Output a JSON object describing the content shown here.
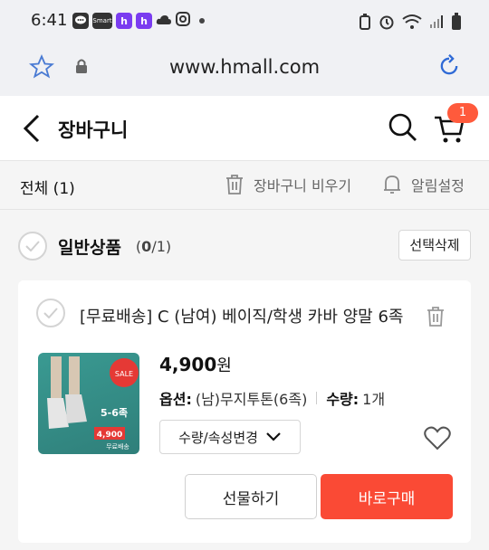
{
  "status_bar": {
    "time": "6:41",
    "icons": [
      "chat-icon",
      "smart-icon",
      "h-app-icon",
      "h-app-icon",
      "cloud-icon",
      "instagram-icon"
    ],
    "smart_label": "Smart",
    "h_label": "h"
  },
  "browser": {
    "url": "www.hmall.com"
  },
  "header": {
    "title": "장바구니",
    "cart_badge": "1"
  },
  "toolbar": {
    "all_label": "전체 (1)",
    "clear_label": "장바구니 비우기",
    "alarm_label": "알림설정"
  },
  "section": {
    "title": "일반상품",
    "count_selected": "0",
    "count_total": "/1)",
    "count_open": "(",
    "delete_selected_label": "선택삭제"
  },
  "product": {
    "name": "[무료배송] C (남여) 베이직/학생 카바 양말 6족",
    "price_number": "4,900",
    "price_unit": "원",
    "option_label": "옵션:",
    "option_value": "(남)무지투톤(6족)",
    "qty_label": "수량:",
    "qty_value": "1개",
    "change_label": "수량/속성변경",
    "gift_label": "선물하기",
    "buy_label": "바로구매",
    "thumb_sale": "SALE",
    "thumb_count": "5-6족",
    "thumb_price": "4,900",
    "thumb_free": "무료배송"
  },
  "colors": {
    "accent": "#fa4a35",
    "badge": "#ff5a3c"
  }
}
